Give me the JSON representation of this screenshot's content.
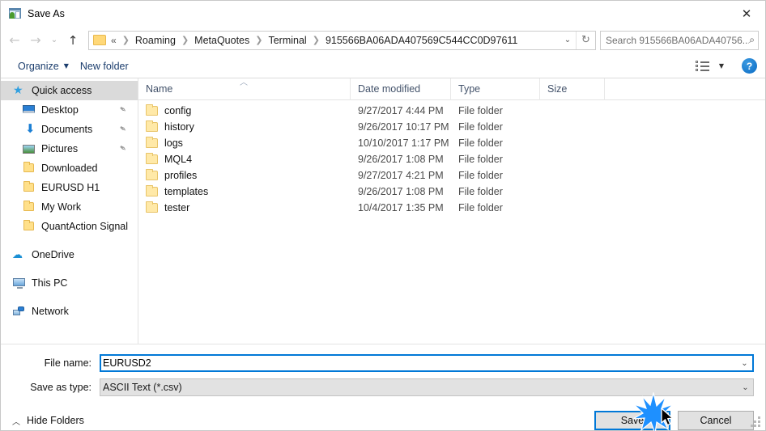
{
  "window": {
    "title": "Save As",
    "icon": "save-as-icon",
    "close_label": "✕"
  },
  "nav": {
    "back_icon": "back-arrow-icon",
    "forward_icon": "forward-arrow-icon",
    "recent_icon": "chevron-down-icon",
    "up_icon": "up-arrow-icon",
    "back_glyph": "←",
    "forward_glyph": "→",
    "recent_glyph": "⌄",
    "up_glyph": "↑",
    "refresh_glyph": "↻",
    "dropdown_glyph": "⌄"
  },
  "address": {
    "root": "«",
    "crumbs": [
      "Roaming",
      "MetaQuotes",
      "Terminal",
      "915566BA06ADA407569C544CC0D97611"
    ],
    "separator": "❯"
  },
  "search": {
    "placeholder": "Search 915566BA06ADA40756...",
    "icon_glyph": "⌕"
  },
  "toolbar": {
    "organize_label": "Organize",
    "organize_caret": "▼",
    "new_folder_label": "New folder",
    "view_caret": "▼",
    "help_label": "?"
  },
  "sidebar": {
    "items": [
      {
        "label": "Quick access",
        "icon": "star-icon",
        "selected": true,
        "indent": false,
        "pinned": false,
        "group": false
      },
      {
        "label": "Desktop",
        "icon": "desktop-icon",
        "selected": false,
        "indent": true,
        "pinned": true,
        "group": false
      },
      {
        "label": "Documents",
        "icon": "documents-icon",
        "selected": false,
        "indent": true,
        "pinned": true,
        "group": false
      },
      {
        "label": "Pictures",
        "icon": "pictures-icon",
        "selected": false,
        "indent": true,
        "pinned": true,
        "group": false
      },
      {
        "label": "Downloaded",
        "icon": "folder-icon",
        "selected": false,
        "indent": true,
        "pinned": false,
        "group": false
      },
      {
        "label": "EURUSD H1",
        "icon": "folder-icon",
        "selected": false,
        "indent": true,
        "pinned": false,
        "group": false
      },
      {
        "label": "My Work",
        "icon": "folder-icon",
        "selected": false,
        "indent": true,
        "pinned": false,
        "group": false
      },
      {
        "label": "QuantAction Signal",
        "icon": "folder-icon",
        "selected": false,
        "indent": true,
        "pinned": false,
        "group": false
      },
      {
        "label": "OneDrive",
        "icon": "onedrive-icon",
        "selected": false,
        "indent": false,
        "pinned": false,
        "group": true
      },
      {
        "label": "This PC",
        "icon": "this-pc-icon",
        "selected": false,
        "indent": false,
        "pinned": false,
        "group": true
      },
      {
        "label": "Network",
        "icon": "network-icon",
        "selected": false,
        "indent": false,
        "pinned": false,
        "group": true
      }
    ],
    "pin_glyph": "📌"
  },
  "filelist": {
    "columns": [
      "Name",
      "Date modified",
      "Type",
      "Size"
    ],
    "sort_caret": "︿",
    "rows": [
      {
        "name": "config",
        "date": "9/27/2017 4:44 PM",
        "type": "File folder",
        "size": ""
      },
      {
        "name": "history",
        "date": "9/26/2017 10:17 PM",
        "type": "File folder",
        "size": ""
      },
      {
        "name": "logs",
        "date": "10/10/2017 1:17 PM",
        "type": "File folder",
        "size": ""
      },
      {
        "name": "MQL4",
        "date": "9/26/2017 1:08 PM",
        "type": "File folder",
        "size": ""
      },
      {
        "name": "profiles",
        "date": "9/27/2017 4:21 PM",
        "type": "File folder",
        "size": ""
      },
      {
        "name": "templates",
        "date": "9/26/2017 1:08 PM",
        "type": "File folder",
        "size": ""
      },
      {
        "name": "tester",
        "date": "10/4/2017 1:35 PM",
        "type": "File folder",
        "size": ""
      }
    ]
  },
  "footer": {
    "file_name_label": "File name:",
    "file_name_value": "EURUSD2",
    "save_as_type_label": "Save as type:",
    "save_as_type_value": "ASCII Text (*.csv)",
    "combo_chevron": "⌄",
    "hide_folders_label": "Hide Folders",
    "hide_folders_chevron": "︿",
    "save_label": "Save",
    "cancel_label": "Cancel"
  },
  "colors": {
    "accent": "#0078d7",
    "selection": "#0b6fc8",
    "toolbar_link": "#1b3d6d",
    "folder_yellow": "#ffe08a",
    "burst": "#1e90ff"
  }
}
